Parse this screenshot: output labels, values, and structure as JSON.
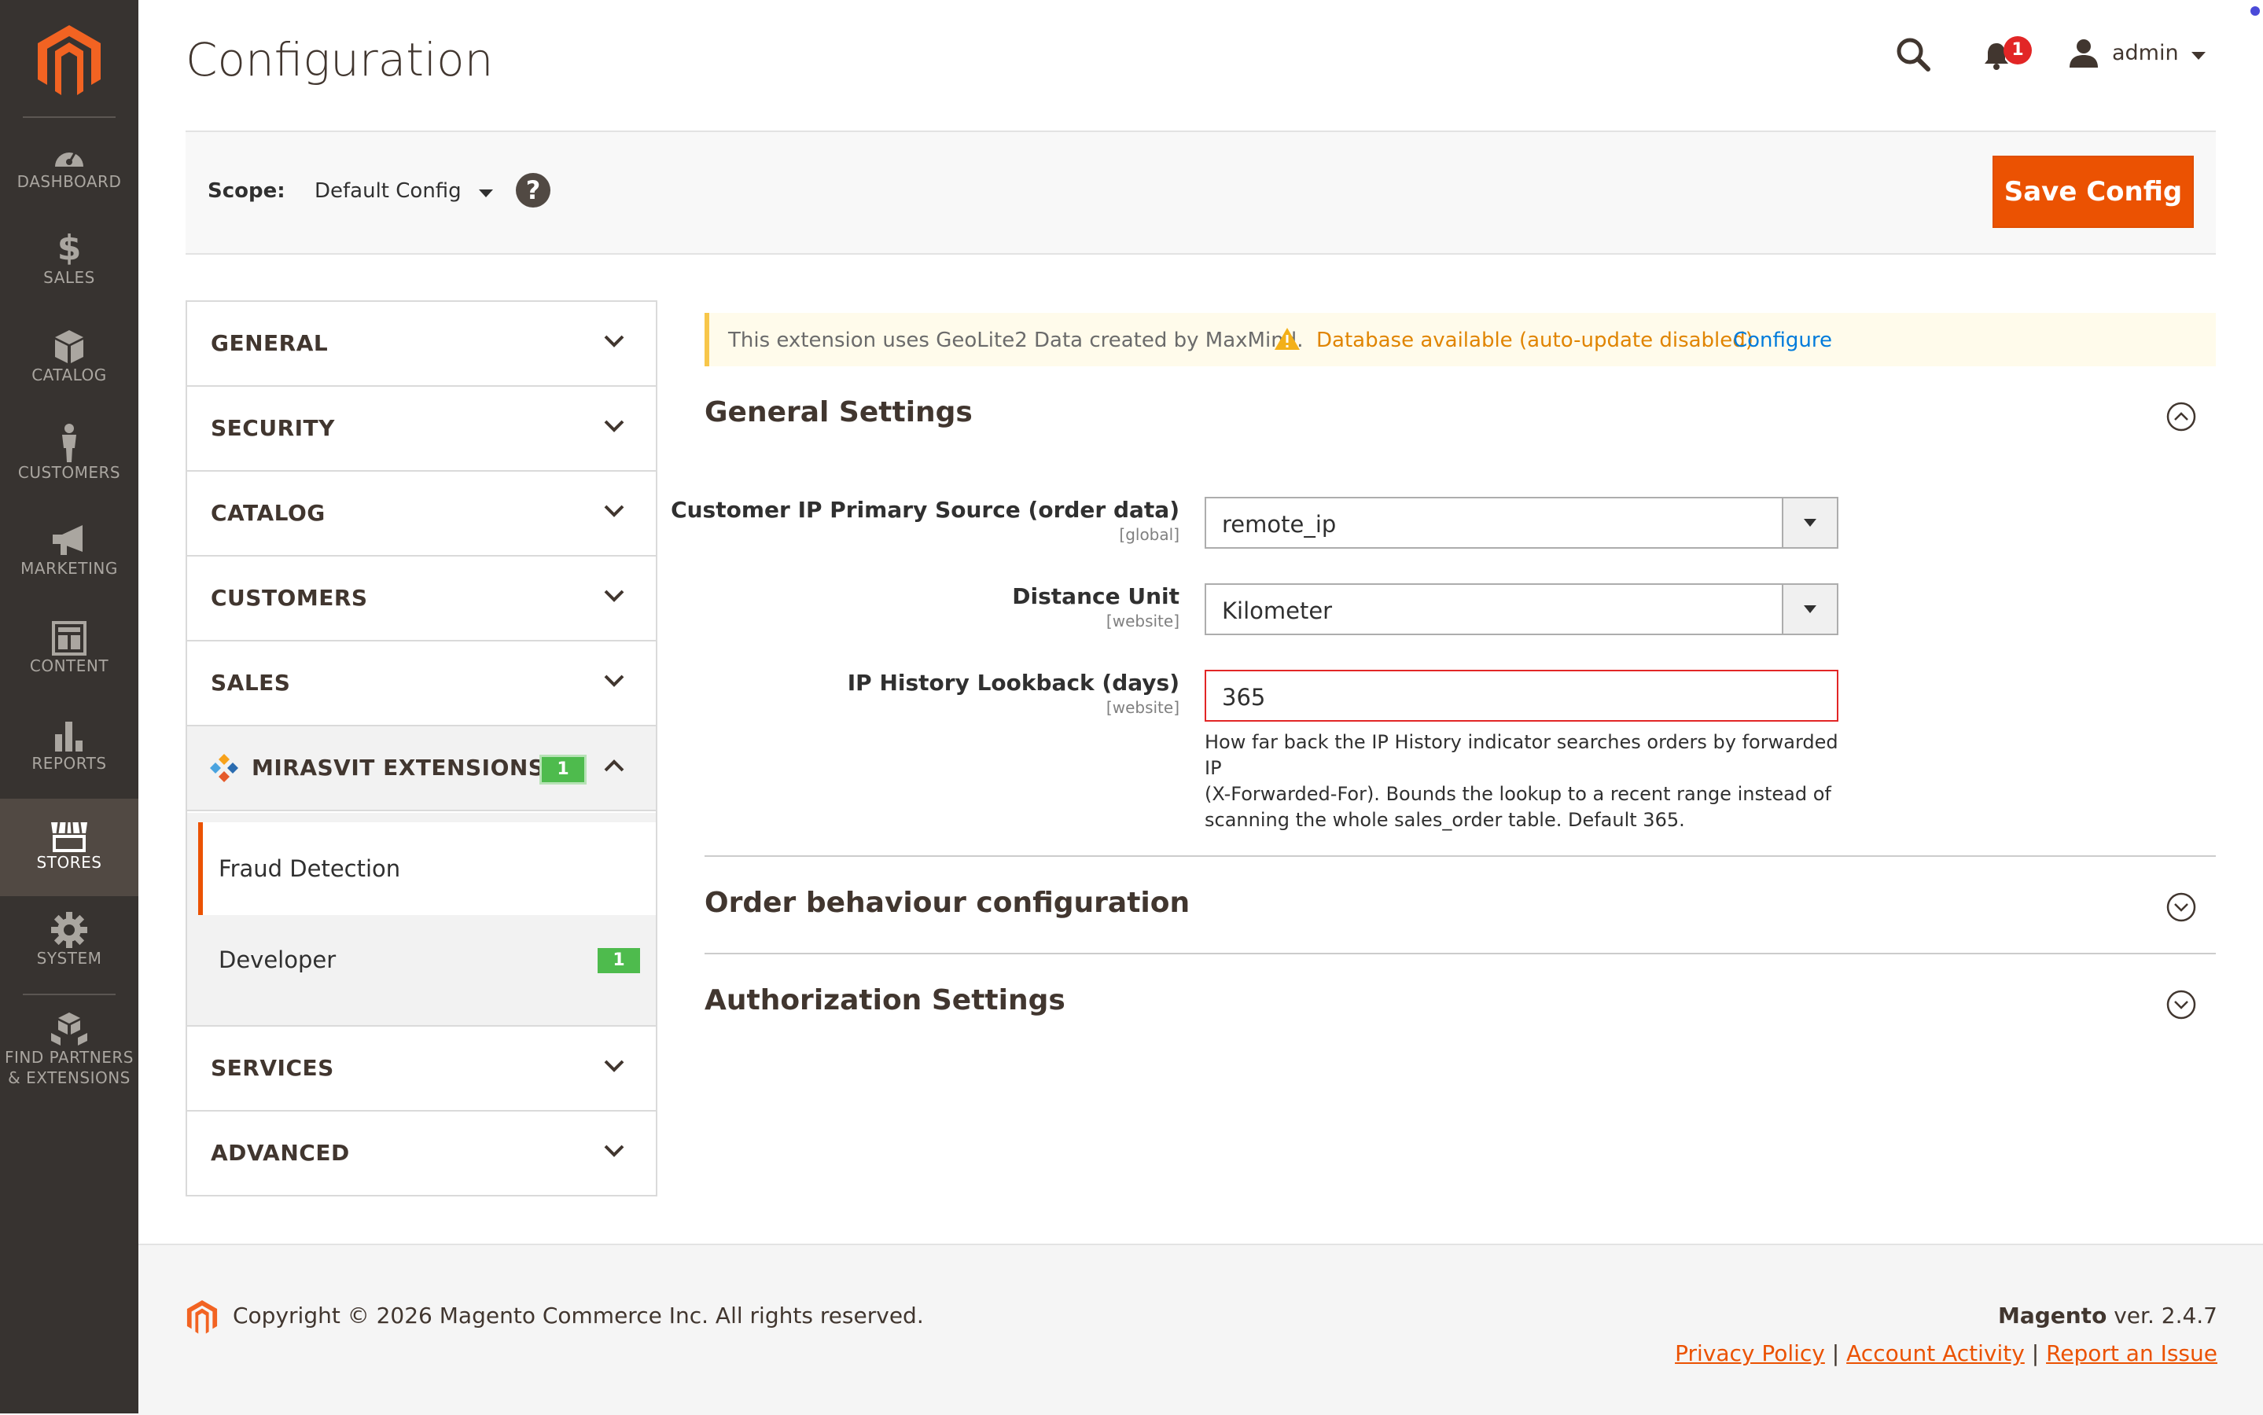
{
  "sidebar": {
    "items": [
      {
        "label": "DASHBOARD",
        "icon": "dashboard-icon"
      },
      {
        "label": "SALES",
        "icon": "dollar-icon"
      },
      {
        "label": "CATALOG",
        "icon": "box-icon"
      },
      {
        "label": "CUSTOMERS",
        "icon": "person-icon"
      },
      {
        "label": "MARKETING",
        "icon": "megaphone-icon"
      },
      {
        "label": "CONTENT",
        "icon": "layout-icon"
      },
      {
        "label": "REPORTS",
        "icon": "bar-chart-icon"
      },
      {
        "label": "STORES",
        "icon": "storefront-icon",
        "active": true
      },
      {
        "label": "SYSTEM",
        "icon": "gear-icon"
      },
      {
        "label_line1": "FIND PARTNERS",
        "label_line2": "& EXTENSIONS",
        "icon": "cubes-icon"
      }
    ]
  },
  "header": {
    "title": "Configuration",
    "notifications_count": "1",
    "user": "admin"
  },
  "scope": {
    "label": "Scope:",
    "value": "Default Config",
    "help": "?",
    "save_label": "Save Config"
  },
  "tabs": {
    "general": "GENERAL",
    "security": "SECURITY",
    "catalog": "CATALOG",
    "customers": "CUSTOMERS",
    "sales": "SALES",
    "mirasvit": "MIRASVIT EXTENSIONS",
    "mirasvit_count": "1",
    "sub_fraud": "Fraud Detection",
    "sub_developer": "Developer",
    "sub_developer_count": "1",
    "services": "SERVICES",
    "advanced": "ADVANCED"
  },
  "notice": {
    "text": "This extension uses GeoLite2 Data created by MaxMind.",
    "status": "Database available (auto-update disabled)",
    "link": "Configure"
  },
  "sections": {
    "general_title": "General Settings",
    "order_title": "Order behaviour configuration",
    "auth_title": "Authorization Settings"
  },
  "fields": {
    "ip_source_label": "Customer IP Primary Source (order data)",
    "ip_source_scope": "[global]",
    "ip_source_value": "remote_ip",
    "distance_label": "Distance Unit",
    "distance_scope": "[website]",
    "distance_value": "Kilometer",
    "lookback_label": "IP History Lookback (days)",
    "lookback_scope": "[website]",
    "lookback_value": "365",
    "lookback_note_1": "How far back the IP History indicator searches orders by forwarded IP",
    "lookback_note_2": "(X-Forwarded-For). Bounds the lookup to a recent range instead of",
    "lookback_note_3": "scanning the whole sales_order table. Default 365."
  },
  "footer": {
    "copyright": "Copyright © 2026 Magento Commerce Inc. All rights reserved.",
    "brand": "Magento",
    "version": " ver. 2.4.7",
    "privacy": "Privacy Policy",
    "activity": "Account Activity",
    "report": "Report an Issue",
    "sep": "|"
  },
  "colors": {
    "accent": "#eb5202",
    "sidebar": "#373330",
    "badge_green": "#4ebb4d",
    "badge_red": "#e22626"
  }
}
